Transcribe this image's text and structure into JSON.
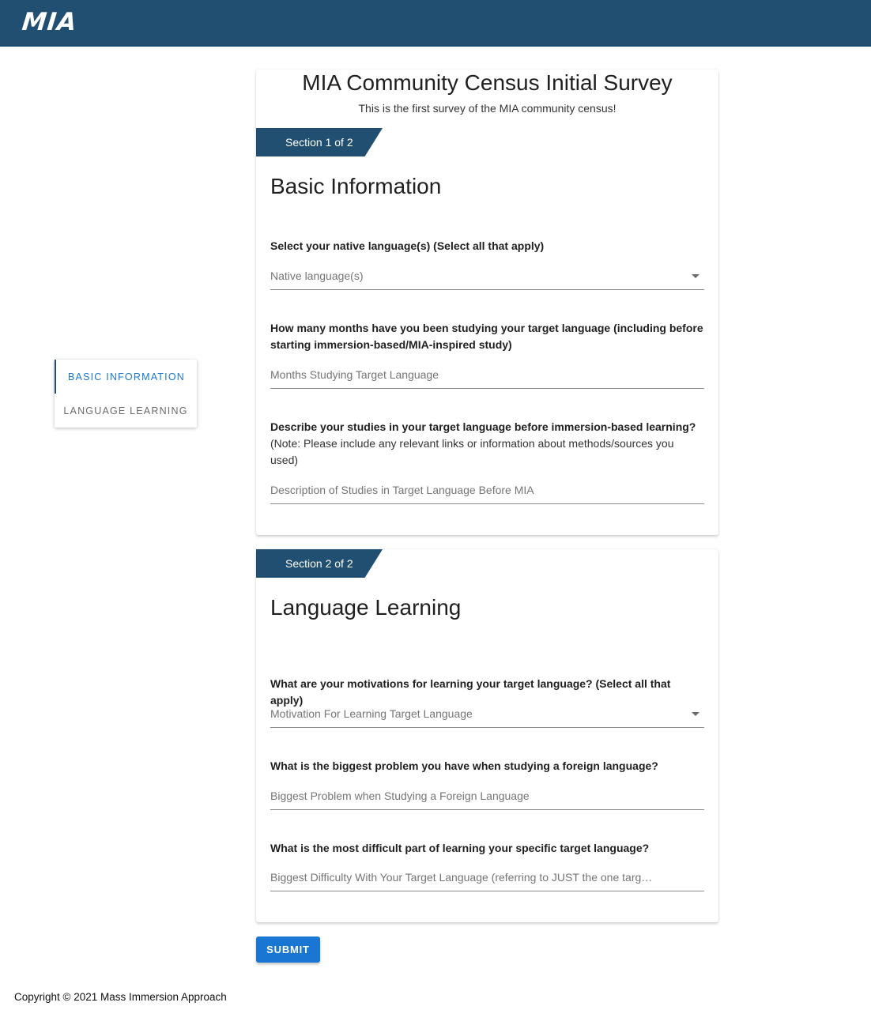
{
  "header": {
    "logo_text": "MIA",
    "background_color": "#214f71"
  },
  "sidenav": {
    "items": [
      {
        "label": "BASIC INFORMATION",
        "active": true
      },
      {
        "label": "LANGUAGE LEARNING",
        "active": false
      }
    ],
    "active_color": "#1976d2"
  },
  "survey": {
    "title": "MIA Community Census Initial Survey",
    "description": "This is the first survey of the MIA community census!"
  },
  "sections": [
    {
      "tab_label": "Section 1 of 2",
      "heading": "Basic Information",
      "questions": [
        {
          "label": "Select your native language(s) (Select all that apply)",
          "placeholder": "Native language(s)",
          "type": "select"
        },
        {
          "label": "How many months have you been studying your target language (including before starting immersion-based/MIA-inspired study)",
          "placeholder": "Months Studying Target Language",
          "type": "text"
        },
        {
          "label": "Describe your studies in your target language before immersion-based learning?",
          "note": "(Note: Please include any relevant links or information about methods/sources you used)",
          "placeholder": "Description of Studies in Target Language Before MIA",
          "type": "text"
        }
      ]
    },
    {
      "tab_label": "Section 2 of 2",
      "heading": "Language Learning",
      "questions": [
        {
          "label": "What are your motivations for learning your target language? (Select all that apply)",
          "placeholder": "Motivation For Learning Target Language",
          "type": "select"
        },
        {
          "label": "What is the biggest problem you have when studying a foreign language?",
          "placeholder": "Biggest Problem when Studying a Foreign Language",
          "type": "text"
        },
        {
          "label": "What is the most difficult part of learning your specific target language?",
          "placeholder": "Biggest Difficulty With Your Target Language (referring to JUST the one targ…",
          "type": "text"
        }
      ]
    }
  ],
  "submit_label": "SUBMIT",
  "footer": {
    "copyright": "Copyright © 2021 Mass Immersion Approach"
  }
}
